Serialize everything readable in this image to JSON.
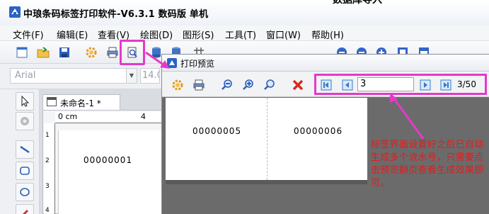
{
  "app": {
    "title": "中琅条码标签打印软件-V6.3.1 数码版 单机",
    "clipped_title": "数据库导入"
  },
  "menu": [
    {
      "label": "文件(F)"
    },
    {
      "label": "编辑(E)"
    },
    {
      "label": "查看(V)"
    },
    {
      "label": "绘图(D)"
    },
    {
      "label": "图形(S)"
    },
    {
      "label": "工具(T)"
    },
    {
      "label": "窗口(W)"
    },
    {
      "label": "帮助(H)"
    }
  ],
  "fontbar": {
    "font_value": "Arial",
    "size_value": "14.0"
  },
  "document": {
    "tab_title": "未命名-1 *",
    "ruler_unit": "0 cm",
    "ruler_zero": "|",
    "ruler_mark": "4",
    "vruler": [
      "1",
      "2",
      "3",
      "4"
    ],
    "label_serial": "00000001"
  },
  "preview": {
    "title": "打印预览",
    "page_input": "3",
    "page_count": "3/50",
    "pages": [
      {
        "serial": "00000005"
      },
      {
        "serial": "00000006"
      }
    ]
  },
  "annotation": "标签界面设置好之后已自动生成多个流水号，只需要点击预览翻页查看生成效果即可。",
  "colors": {
    "highlight": "#e43ac9",
    "annotation": "#e21c1c"
  }
}
